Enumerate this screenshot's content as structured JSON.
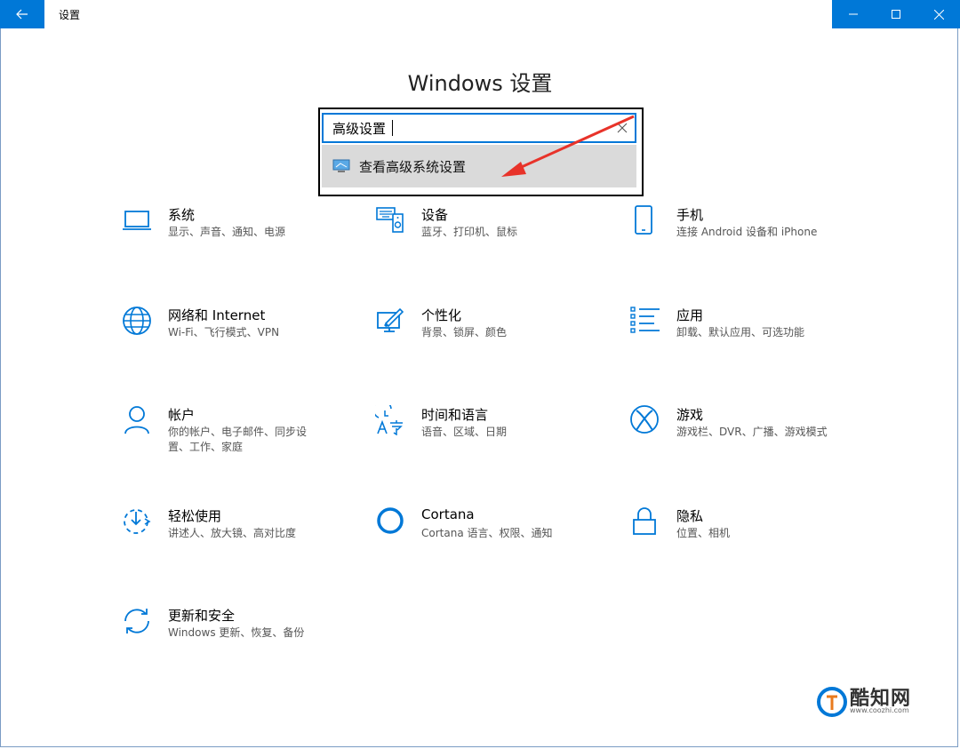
{
  "window": {
    "title": "设置"
  },
  "page": {
    "title": "Windows 设置"
  },
  "search": {
    "value": "高级设置"
  },
  "suggestion": {
    "label": "查看高级系统设置"
  },
  "categories": [
    {
      "id": "system",
      "name": "系统",
      "desc": "显示、声音、通知、电源",
      "icon": "laptop-icon"
    },
    {
      "id": "devices",
      "name": "设备",
      "desc": "蓝牙、打印机、鼠标",
      "icon": "keyboard-speaker-icon"
    },
    {
      "id": "phone",
      "name": "手机",
      "desc": "连接 Android 设备和 iPhone",
      "icon": "phone-icon"
    },
    {
      "id": "network",
      "name": "网络和 Internet",
      "desc": "Wi-Fi、飞行模式、VPN",
      "icon": "globe-icon"
    },
    {
      "id": "personalization",
      "name": "个性化",
      "desc": "背景、锁屏、颜色",
      "icon": "paint-icon"
    },
    {
      "id": "apps",
      "name": "应用",
      "desc": "卸载、默认应用、可选功能",
      "icon": "list-icon"
    },
    {
      "id": "accounts",
      "name": "帐户",
      "desc": "你的帐户、电子邮件、同步设置、工作、家庭",
      "icon": "person-icon"
    },
    {
      "id": "time-language",
      "name": "时间和语言",
      "desc": "语音、区域、日期",
      "icon": "time-language-icon"
    },
    {
      "id": "gaming",
      "name": "游戏",
      "desc": "游戏栏、DVR、广播、游戏模式",
      "icon": "xbox-icon"
    },
    {
      "id": "ease-of-access",
      "name": "轻松使用",
      "desc": "讲述人、放大镜、高对比度",
      "icon": "ease-of-access-icon"
    },
    {
      "id": "cortana",
      "name": "Cortana",
      "desc": "Cortana 语言、权限、通知",
      "icon": "cortana-icon"
    },
    {
      "id": "privacy",
      "name": "隐私",
      "desc": "位置、相机",
      "icon": "lock-icon"
    },
    {
      "id": "update-security",
      "name": "更新和安全",
      "desc": "Windows 更新、恢复、备份",
      "icon": "sync-icon"
    }
  ],
  "watermark": {
    "text": "酷知网",
    "url": "www.coozhi.com"
  },
  "colors": {
    "accent": "#0078d7",
    "annotation": "#e8332a"
  }
}
